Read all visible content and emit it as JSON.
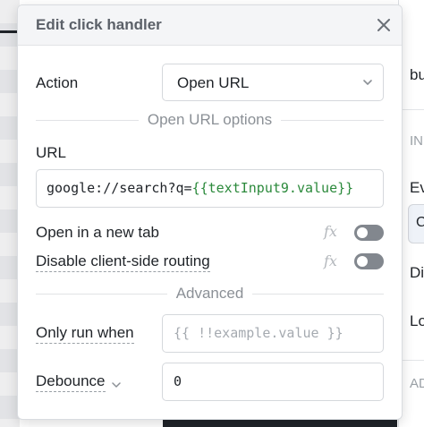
{
  "popover": {
    "title": "Edit click handler",
    "action_label": "Action",
    "action_value": "Open URL",
    "options_section": "Open URL options",
    "url_label": "URL",
    "url_value_prefix": "google://search?q=",
    "url_value_template": "{{textInput9.value}}",
    "open_new_tab_label": "Open in a new tab",
    "open_new_tab_on": false,
    "disable_routing_label": "Disable client-side routing",
    "disable_routing_on": false,
    "fx_label": "fx",
    "advanced_section": "Advanced",
    "only_run_label": "Only run when",
    "only_run_placeholder": "{{ !!example.value }}",
    "debounce_label": "Debounce",
    "debounce_value": "0"
  },
  "right_panel": {
    "top_text": "bu",
    "section_text": "IN",
    "ev_text": "Ev",
    "chip_text": "C",
    "di_text": "Di",
    "lo_text": "Lo",
    "ad_text": "AD"
  },
  "icons": {
    "close": "close-icon",
    "select_chevron": "chevron-down-icon",
    "debounce_chevron": "chevron-down-icon"
  },
  "colors": {
    "template_green": "#2c8a3c",
    "toggle_off": "#82878e",
    "header_bg": "#f4f5f7"
  }
}
